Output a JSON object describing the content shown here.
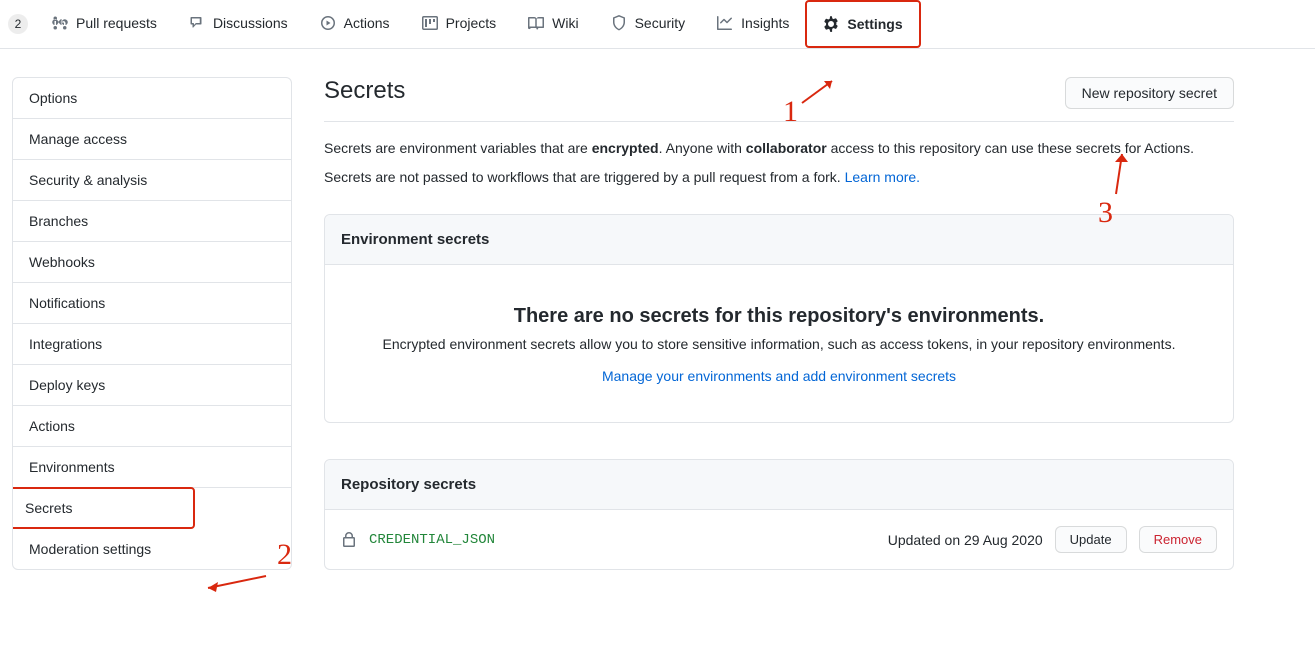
{
  "counter": "2",
  "tabs": {
    "pullrequests": "Pull requests",
    "discussions": "Discussions",
    "actions": "Actions",
    "projects": "Projects",
    "wiki": "Wiki",
    "security": "Security",
    "insights": "Insights",
    "settings": "Settings"
  },
  "sidebar": {
    "items": [
      "Options",
      "Manage access",
      "Security & analysis",
      "Branches",
      "Webhooks",
      "Notifications",
      "Integrations",
      "Deploy keys",
      "Actions",
      "Environments",
      "Secrets",
      "Moderation settings"
    ]
  },
  "page": {
    "title": "Secrets",
    "new_secret_btn": "New repository secret",
    "desc1_a": "Secrets are environment variables that are ",
    "desc1_b": "encrypted",
    "desc1_c": ". Anyone with ",
    "desc1_d": "collaborator",
    "desc1_e": " access to this repository can use these secrets for Actions.",
    "desc2_a": "Secrets are not passed to workflows that are triggered by a pull request from a fork. ",
    "learn_more": "Learn more."
  },
  "env_box": {
    "header": "Environment secrets",
    "title": "There are no secrets for this repository's environments.",
    "text": "Encrypted environment secrets allow you to store sensitive information, such as access tokens, in your repository environments.",
    "link": "Manage your environments and add environment secrets"
  },
  "repo_box": {
    "header": "Repository secrets",
    "secret_name": "CREDENTIAL_JSON",
    "updated": "Updated on 29 Aug 2020",
    "update_btn": "Update",
    "remove_btn": "Remove"
  },
  "annotations": {
    "n1": "1",
    "n2": "2",
    "n3": "3"
  }
}
